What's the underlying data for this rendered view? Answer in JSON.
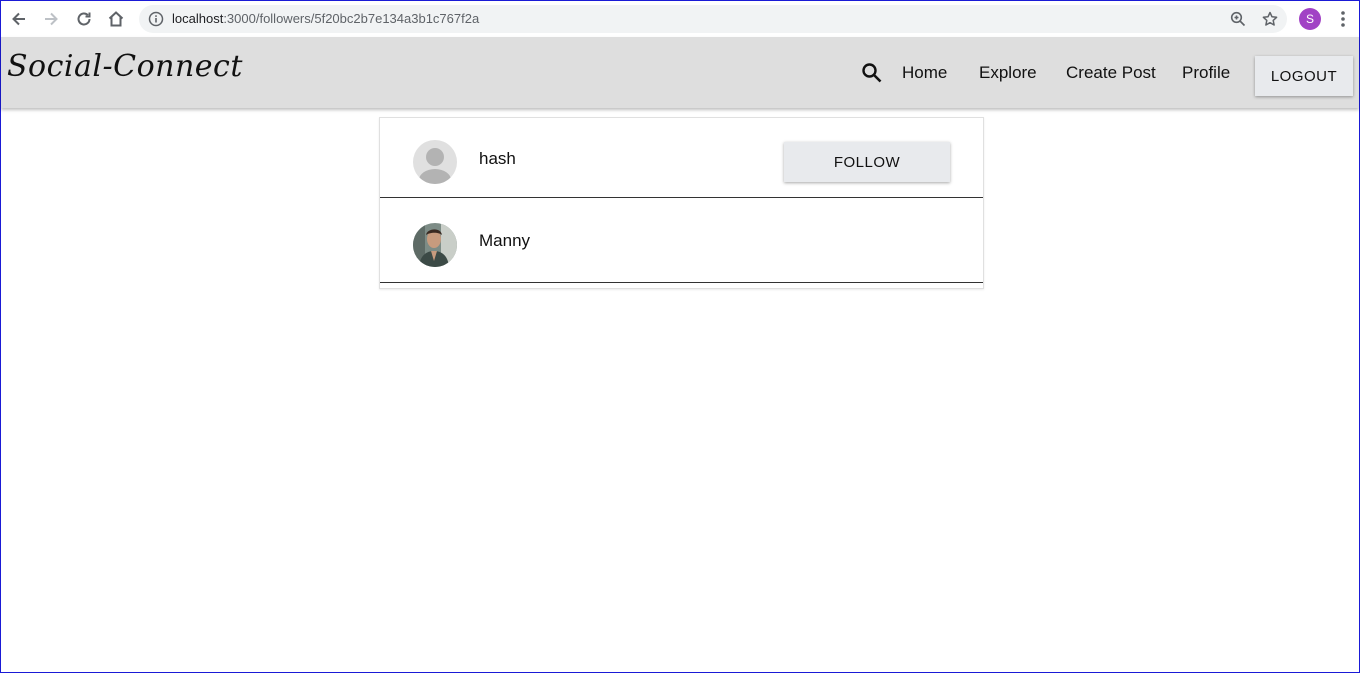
{
  "browser": {
    "url_host": "localhost",
    "url_path": ":3000/followers/5f20bc2b7e134a3b1c767f2a",
    "profile_initial": "S",
    "profile_color": "#a142c5"
  },
  "navbar": {
    "brand": "Social-Connect",
    "links": [
      "Home",
      "Explore",
      "Create Post",
      "Profile"
    ],
    "logout_label": "LOGOUT",
    "search_icon": "search-icon"
  },
  "followers": [
    {
      "name": "hash",
      "avatar": "default-avatar",
      "follow_label": "FOLLOW"
    },
    {
      "name": "Manny",
      "avatar": "photo-avatar"
    }
  ]
}
